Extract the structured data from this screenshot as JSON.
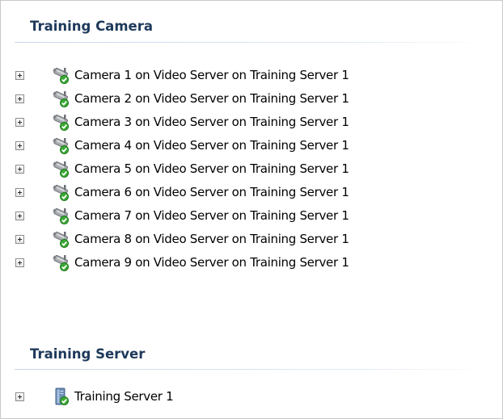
{
  "sections": [
    {
      "title": "Training Camera",
      "items": [
        {
          "label": "Camera 1 on Video Server on Training Server 1",
          "icon": "camera-ok-icon"
        },
        {
          "label": "Camera 2 on Video Server on Training Server 1",
          "icon": "camera-ok-icon"
        },
        {
          "label": "Camera 3 on Video Server on Training Server 1",
          "icon": "camera-ok-icon"
        },
        {
          "label": "Camera 4 on Video Server on Training Server 1",
          "icon": "camera-ok-icon"
        },
        {
          "label": "Camera 5 on Video Server on Training Server 1",
          "icon": "camera-ok-icon"
        },
        {
          "label": "Camera 6 on Video Server on Training Server 1",
          "icon": "camera-ok-icon"
        },
        {
          "label": "Camera 7 on Video Server on Training Server 1",
          "icon": "camera-ok-icon"
        },
        {
          "label": "Camera 8 on Video Server on Training Server 1",
          "icon": "camera-ok-icon"
        },
        {
          "label": "Camera 9 on Video Server on Training Server 1",
          "icon": "camera-ok-icon"
        }
      ]
    },
    {
      "title": "Training Server",
      "items": [
        {
          "label": "Training Server 1",
          "icon": "server-ok-icon"
        }
      ]
    }
  ],
  "colors": {
    "header_text": "#1e395b",
    "status_ok": "#3aa935"
  }
}
